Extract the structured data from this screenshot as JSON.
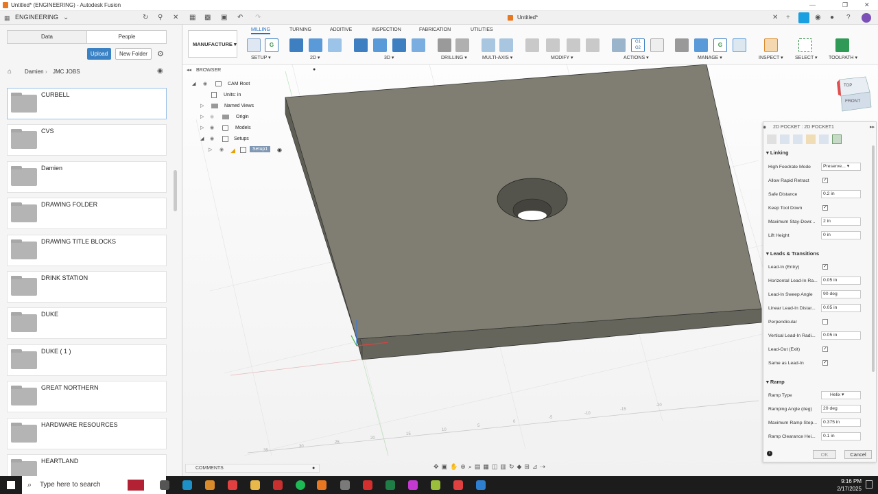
{
  "window": {
    "title": "Untitled* (ENGINEERING) - Autodesk Fusion"
  },
  "header": {
    "workspace": "ENGINEERING",
    "doc_tab": "Untitled*"
  },
  "data_panel": {
    "tabs": [
      "Data",
      "People"
    ],
    "upload": "Upload",
    "new_folder": "New Folder",
    "breadcrumb": [
      "Damien",
      "JMC JOBS"
    ],
    "folders": [
      "CURBELL",
      "CVS",
      "Damien",
      "DRAWING FOLDER",
      "DRAWING TITLE BLOCKS",
      "DRINK STATION",
      "DUKE",
      "DUKE ( 1 )",
      "GREAT NORTHERN",
      "HARDWARE RESOURCES",
      "HEARTLAND"
    ]
  },
  "toolbar": {
    "workspace_btn": "MANUFACTURE",
    "tabs": [
      "MILLING",
      "TURNING",
      "ADDITIVE",
      "INSPECTION",
      "FABRICATION",
      "UTILITIES"
    ],
    "active_tab": "MILLING",
    "groups": [
      "SETUP",
      "2D",
      "3D",
      "DRILLING",
      "MULTI-AXIS",
      "MODIFY",
      "ACTIONS",
      "MANAGE",
      "INSPECT",
      "SELECT",
      "TOOLPATH"
    ]
  },
  "browser": {
    "title": "BROWSER",
    "nodes": [
      "CAM Root",
      "Units: in",
      "Named Views",
      "Origin",
      "Models",
      "Setups",
      "Setup1"
    ]
  },
  "comments": "COMMENTS",
  "viewcube": {
    "top": "TOP",
    "front": "FRONT"
  },
  "ruler_labels": [
    "35",
    "30",
    "25",
    "20",
    "15",
    "10",
    "5",
    "0",
    "-5",
    "-10",
    "-15",
    "-20"
  ],
  "pocket_dialog": {
    "title": "2D POCKET : 2D POCKET1",
    "sections": {
      "linking": "Linking",
      "leads": "Leads & Transitions",
      "ramp": "Ramp"
    },
    "linking": [
      {
        "label": "High Feedrate Mode",
        "type": "select",
        "value": "Preserve..."
      },
      {
        "label": "Allow Rapid Retract",
        "type": "check",
        "checked": true
      },
      {
        "label": "Safe Distance",
        "type": "input",
        "value": "0.2 in"
      },
      {
        "label": "Keep Tool Down",
        "type": "check",
        "checked": true
      },
      {
        "label": "Maximum Stay-Dowr...",
        "type": "input",
        "value": "2 in"
      },
      {
        "label": "Lift Height",
        "type": "input",
        "value": "0 in"
      }
    ],
    "leads": [
      {
        "label": "Lead-In (Entry)",
        "type": "check",
        "checked": true
      },
      {
        "label": "Horizontal Lead-In Ra...",
        "type": "input",
        "value": "0.05 in"
      },
      {
        "label": "Lead-In Sweep Angle",
        "type": "input",
        "value": "90 deg"
      },
      {
        "label": "Linear Lead-In Distar...",
        "type": "input",
        "value": "0.05 in"
      },
      {
        "label": "Perpendicular",
        "type": "check",
        "checked": false
      },
      {
        "label": "Vertical Lead-In Radi...",
        "type": "input",
        "value": "0.05 in"
      },
      {
        "label": "Lead-Out (Exit)",
        "type": "check",
        "checked": true
      },
      {
        "label": "Same as Lead-In",
        "type": "check",
        "checked": true
      }
    ],
    "ramp": [
      {
        "label": "Ramp Type",
        "type": "select",
        "value": "Helix"
      },
      {
        "label": "Ramping Angle (deg)",
        "type": "input",
        "value": "20 deg"
      },
      {
        "label": "Maximum Ramp Step...",
        "type": "input",
        "value": "0.375 in"
      },
      {
        "label": "Ramp Clearance Hei...",
        "type": "input",
        "value": "0.1 in"
      }
    ],
    "ok": "OK",
    "cancel": "Cancel"
  },
  "taskbar": {
    "search": "Type here to search",
    "time": "9:16 PM",
    "date": "2/17/2025"
  },
  "colors": {
    "accent": "#1f6fc4",
    "part": "#7d7b6f",
    "upload": "#3b82c4"
  }
}
